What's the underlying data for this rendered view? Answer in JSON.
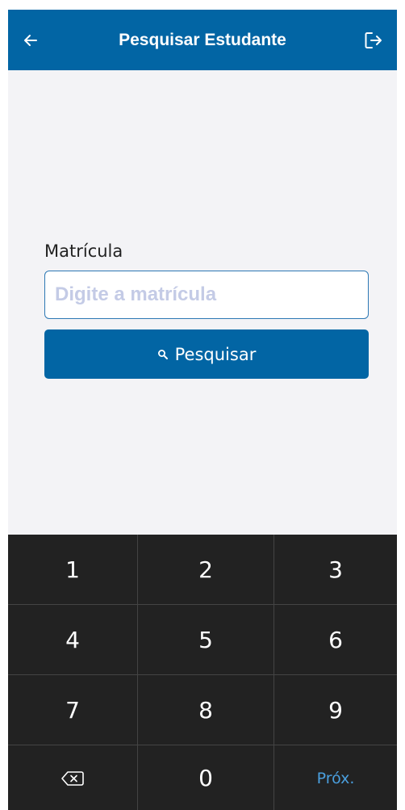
{
  "header": {
    "title": "Pesquisar Estudante",
    "back_icon": "arrow-left-icon",
    "logout_icon": "logout-icon"
  },
  "form": {
    "label": "Matrícula",
    "placeholder": "Digite a matrícula",
    "value": "",
    "search_button_label": "Pesquisar",
    "search_icon": "search-icon"
  },
  "keypad": {
    "keys": [
      "1",
      "2",
      "3",
      "4",
      "5",
      "6",
      "7",
      "8",
      "9"
    ],
    "backspace_icon": "backspace-icon",
    "zero": "0",
    "next_label": "Próx."
  },
  "colors": {
    "primary": "#0265a4",
    "background": "#f3f3f6",
    "keypad_bg": "#222222",
    "next_accent": "#4a9fde"
  }
}
